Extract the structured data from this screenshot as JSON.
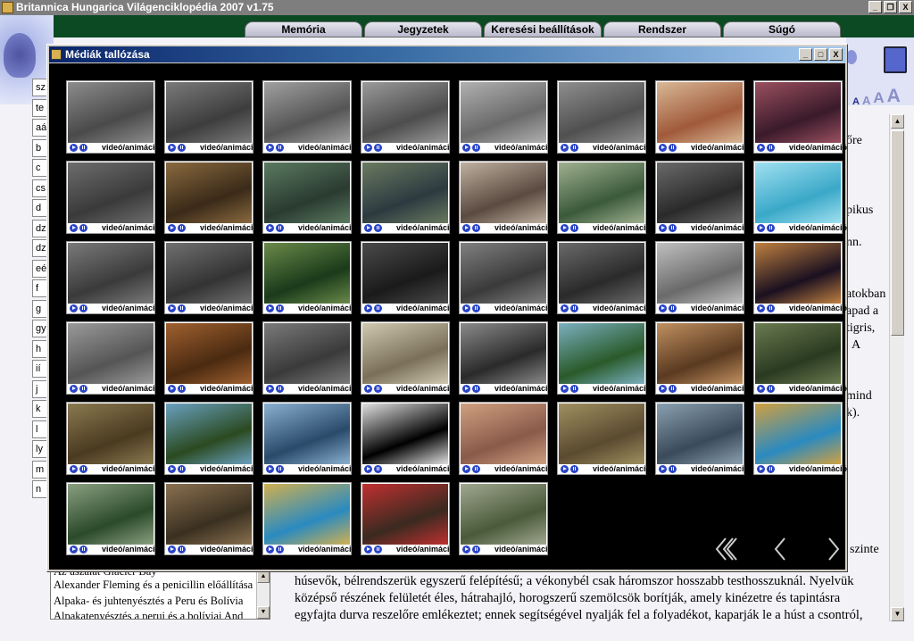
{
  "app": {
    "title": "Britannica Hungarica Világenciklopédia 2007 v1.75",
    "minimize": "_",
    "restore": "❐",
    "close": "X"
  },
  "menu": [
    "Memória",
    "Jegyzetek",
    "Keresési beállítások",
    "Rendszer",
    "Súgó"
  ],
  "font_size_buttons": [
    "A",
    "A",
    "A",
    "A"
  ],
  "alphabet_index": [
    "sz",
    "te",
    "aá",
    "b",
    "c",
    "cs",
    "d",
    "dz",
    "dzs",
    "eé",
    "f",
    "g",
    "gy",
    "h",
    "ií",
    "j",
    "k",
    "l",
    "ly",
    "m",
    "n"
  ],
  "article_snippets": [
    "őre",
    "pikus",
    "nn.",
    "atokban",
    "apad a",
    "tigris,",
    "A",
    "mind",
    "k).",
    "szinte"
  ],
  "bottom_list": {
    "partial_top": "Az úszalat Glacier Bay",
    "items": [
      "Alexander Fleming és a penicillin előállítása",
      "Alpaka- és juhtenyésztés a Peru és Bolívia",
      "Alpakatenyésztés a perui és a bolíviai And"
    ]
  },
  "article_text": [
    "húsevők, bélrendszerük egyszerű felépítésű; a vékonybél csak háromszor hosszabb testhosszuknál. Nyelvük",
    "középső részének felületét éles, hátrahajló, horogszerű szemölcsök borítják, amely kinézetre és tapintásra",
    "egyfajta durva reszelőre emlékeztet; ennek segítségével nyalják fel a folyadékot, kaparják le a húst a csontról,"
  ],
  "media_window": {
    "title": "Médiák tallózása",
    "tile_label": "videó/animáció",
    "tiles": [
      {
        "colors": [
          "#4a4a4a",
          "#8c8c8c"
        ]
      },
      {
        "colors": [
          "#3d3d3d",
          "#7a7a7a"
        ]
      },
      {
        "colors": [
          "#555",
          "#a0a0a0"
        ]
      },
      {
        "colors": [
          "#4d4d4d",
          "#9a9a9a"
        ]
      },
      {
        "colors": [
          "#6a6a6a",
          "#b0b0b0"
        ]
      },
      {
        "colors": [
          "#505050",
          "#8e8e8e"
        ]
      },
      {
        "colors": [
          "#a05a3a",
          "#d9b896"
        ]
      },
      {
        "colors": [
          "#3a1a2a",
          "#9a5060"
        ]
      },
      {
        "colors": [
          "#3a3a3a",
          "#6d6d6d"
        ]
      },
      {
        "colors": [
          "#3a2a18",
          "#8a6a40"
        ]
      },
      {
        "colors": [
          "#2a3a30",
          "#5a7a60"
        ]
      },
      {
        "colors": [
          "#2c3a40",
          "#6a7a60"
        ]
      },
      {
        "colors": [
          "#5a4a40",
          "#c0b0a0"
        ]
      },
      {
        "colors": [
          "#3a5a3a",
          "#a0b090"
        ]
      },
      {
        "colors": [
          "#2a2a2a",
          "#6a6a6a"
        ]
      },
      {
        "colors": [
          "#3aa8c8",
          "#a0e0f0"
        ]
      },
      {
        "colors": [
          "#3a3a3a",
          "#7a7a7a"
        ]
      },
      {
        "colors": [
          "#333",
          "#707070"
        ]
      },
      {
        "colors": [
          "#1a3a1a",
          "#6a8a4a"
        ]
      },
      {
        "colors": [
          "#1a1a1a",
          "#4a4a4a"
        ]
      },
      {
        "colors": [
          "#3a3a3a",
          "#808080"
        ]
      },
      {
        "colors": [
          "#2a2a2a",
          "#6a6a6a"
        ]
      },
      {
        "colors": [
          "#6a6a6a",
          "#c0c0c0"
        ]
      },
      {
        "colors": [
          "#1a1020",
          "#c08040"
        ]
      },
      {
        "colors": [
          "#555",
          "#9a9a9a"
        ]
      },
      {
        "colors": [
          "#4a2a10",
          "#a06030"
        ]
      },
      {
        "colors": [
          "#3a3a3a",
          "#7a7a7a"
        ]
      },
      {
        "colors": [
          "#7a705a",
          "#d0c8b0"
        ]
      },
      {
        "colors": [
          "#2a2a2a",
          "#8a8a8a"
        ]
      },
      {
        "colors": [
          "#2a5a2a",
          "#7ab0c0"
        ]
      },
      {
        "colors": [
          "#5a3a20",
          "#c09060"
        ]
      },
      {
        "colors": [
          "#2a3a20",
          "#6a7a50"
        ]
      },
      {
        "colors": [
          "#4a3a20",
          "#8a7a50"
        ]
      },
      {
        "colors": [
          "#2a4a20",
          "#6aa0c0"
        ]
      },
      {
        "colors": [
          "#2a4a6a",
          "#8ab0d0"
        ]
      },
      {
        "colors": [
          "#000",
          "#e0e0e0"
        ]
      },
      {
        "colors": [
          "#8a5a4a",
          "#d0a080"
        ]
      },
      {
        "colors": [
          "#5a4a30",
          "#a09060"
        ]
      },
      {
        "colors": [
          "#3a4a5a",
          "#8aa0b0"
        ]
      },
      {
        "colors": [
          "#2a8ac0",
          "#d0a040"
        ]
      },
      {
        "colors": [
          "#2a4a2a",
          "#8aa080"
        ]
      },
      {
        "colors": [
          "#3a3020",
          "#8a7050"
        ]
      },
      {
        "colors": [
          "#2a8ac0",
          "#d0b050"
        ]
      },
      {
        "colors": [
          "#3a2a20",
          "#c03030"
        ]
      },
      {
        "colors": [
          "#4a5a3a",
          "#a0a890"
        ]
      }
    ],
    "nav": {
      "first": "first-page",
      "prev": "previous-page",
      "next": "next-page"
    }
  }
}
